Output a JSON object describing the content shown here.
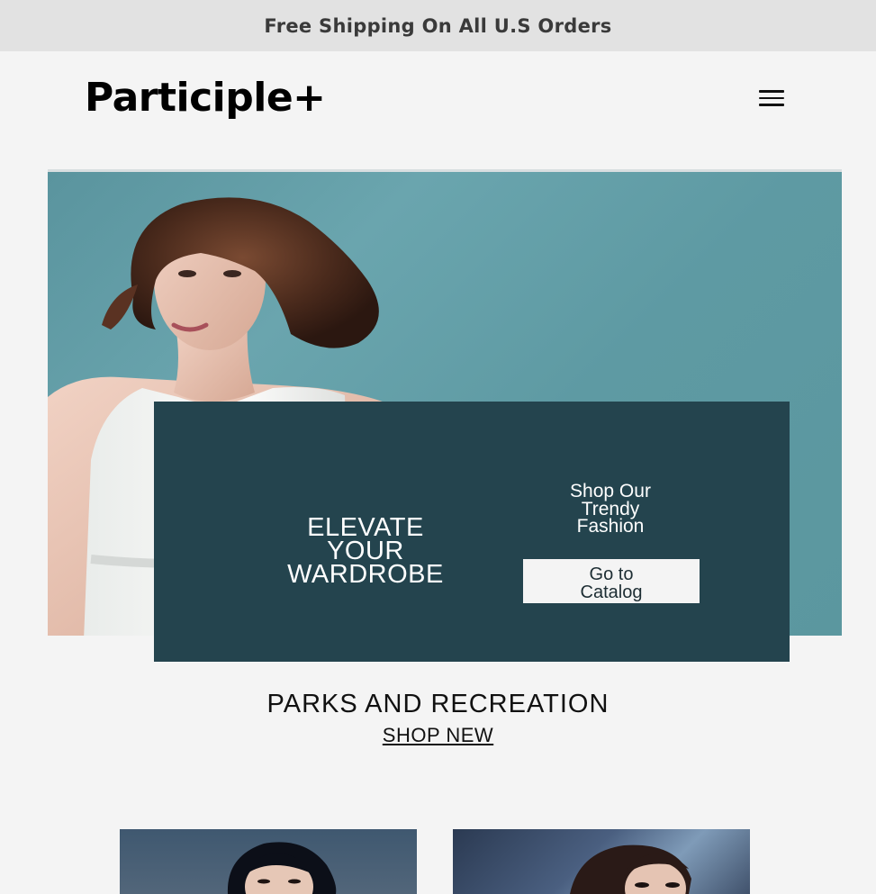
{
  "promo": {
    "text": "Free Shipping On All U.S Orders"
  },
  "header": {
    "logo": "Participle+",
    "menu_icon": "hamburger-menu-icon"
  },
  "hero": {
    "headline_lines": [
      "ELEVATE",
      "YOUR",
      "WARDROBE"
    ],
    "subheading_lines": [
      "Shop Our",
      "Trendy",
      "Fashion"
    ],
    "cta_lines": [
      "Go to",
      "Catalog"
    ],
    "image": "woman-in-white-dress-photo"
  },
  "section": {
    "title": "PARKS AND RECREATION",
    "link": "SHOP NEW"
  },
  "products": [
    {
      "image": "woman-portrait-photo-1"
    },
    {
      "image": "woman-portrait-photo-2"
    }
  ],
  "colors": {
    "promo_bg": "#e2e2e2",
    "hero_bg": "#5e9aa3",
    "card_bg": "#24444e",
    "page_bg": "#f4f4f4"
  }
}
